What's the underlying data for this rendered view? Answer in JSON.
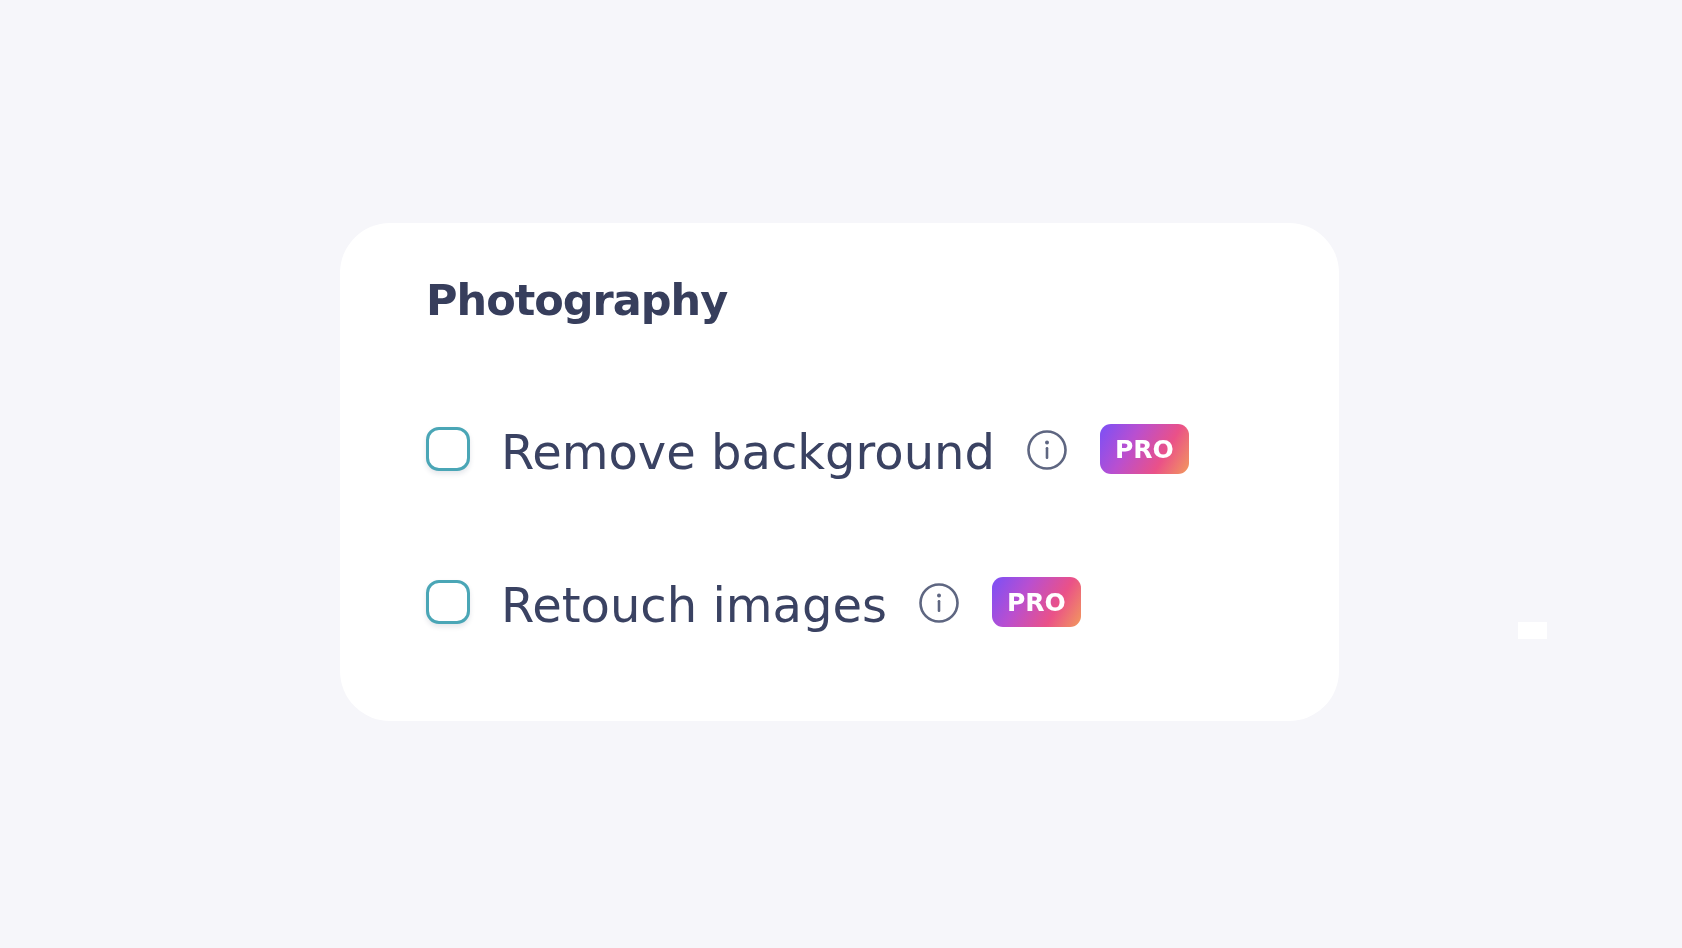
{
  "section": {
    "title": "Photography",
    "options": [
      {
        "label": "Remove background",
        "checked": false,
        "badge": "PRO"
      },
      {
        "label": "Retouch images",
        "checked": false,
        "badge": "PRO"
      }
    ]
  }
}
